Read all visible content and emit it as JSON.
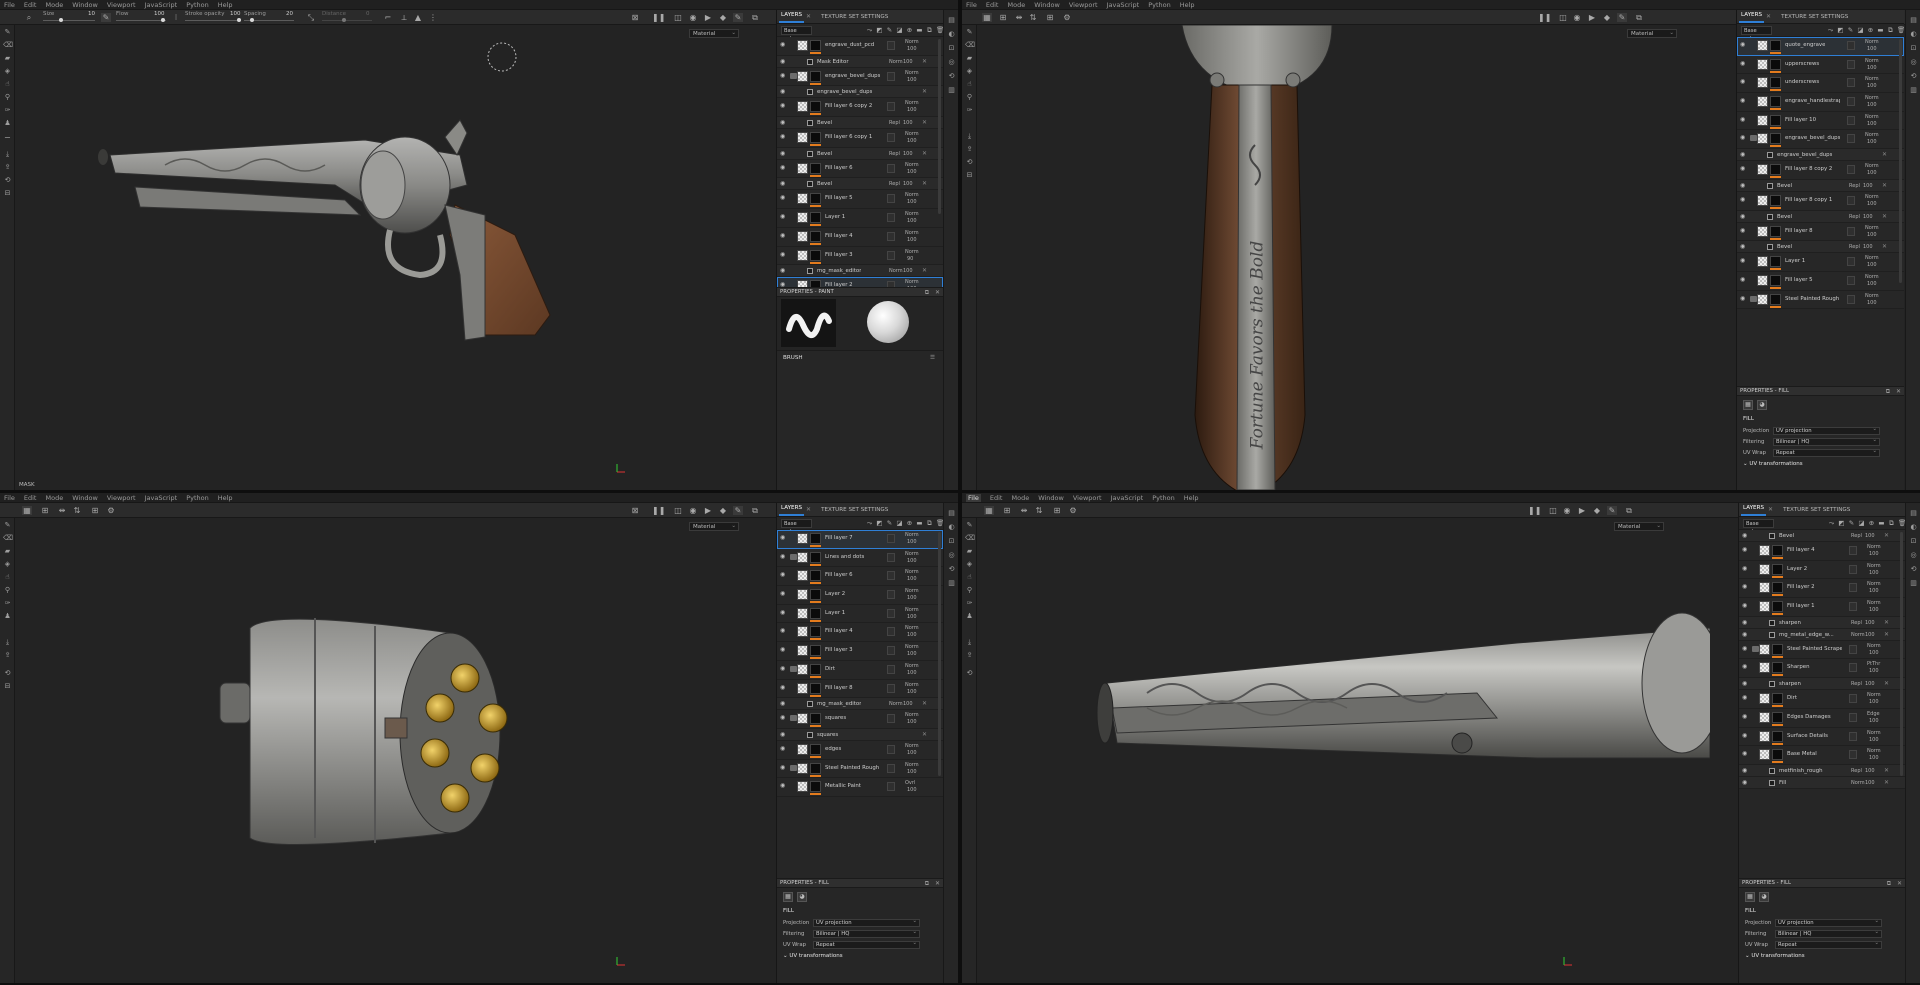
{
  "menu": [
    "File",
    "Edit",
    "Mode",
    "Window",
    "Viewport",
    "JavaScript",
    "Python",
    "Help"
  ],
  "toolbar": {
    "size_label": "Size",
    "size_value": "10",
    "flow_label": "Flow",
    "flow_value": "100",
    "stroke_label": "Stroke opacity",
    "stroke_value": "100",
    "spacing_label": "Spacing",
    "spacing_value": "20",
    "distance_label": "Distance",
    "distance_value": "0"
  },
  "tabs": {
    "layers": "LAYERS",
    "texture_set": "TEXTURE SET SETTINGS"
  },
  "channel": "Base color",
  "material_select": "Material",
  "mask_label": "MASK",
  "panel1": {
    "layers": [
      {
        "name": "engrave_dust_pcd",
        "blend": "Norm",
        "opacity": "100",
        "type": "fill",
        "kind": "paint"
      },
      {
        "name": "Mask Editor",
        "blend": "Norm",
        "opacity": "100",
        "sub": true
      },
      {
        "name": "engrave_bevel_dups",
        "blend": "Norm",
        "opacity": "100",
        "type": "folder"
      },
      {
        "name": "engrave_bevel_dups",
        "sub": true,
        "anchor": true
      },
      {
        "name": "Fill layer 6 copy 2",
        "blend": "Norm",
        "opacity": "100"
      },
      {
        "name": "Bevel",
        "blend": "Repl",
        "opacity": "100",
        "sub": true
      },
      {
        "name": "Fill layer 6 copy 1",
        "blend": "Norm",
        "opacity": "100"
      },
      {
        "name": "Bevel",
        "blend": "Repl",
        "opacity": "100",
        "sub": true
      },
      {
        "name": "Fill layer 6",
        "blend": "Norm",
        "opacity": "100"
      },
      {
        "name": "Bevel",
        "blend": "Repl",
        "opacity": "100",
        "sub": true
      },
      {
        "name": "Fill layer 5",
        "blend": "Norm",
        "opacity": "100"
      },
      {
        "name": "Layer 1",
        "blend": "Norm",
        "opacity": "100"
      },
      {
        "name": "Fill layer 4",
        "blend": "Norm",
        "opacity": "100"
      },
      {
        "name": "Fill layer 3",
        "blend": "Norm",
        "opacity": "90"
      },
      {
        "name": "mg_mask_editor",
        "blend": "Norm",
        "opacity": "100",
        "sub": true
      },
      {
        "name": "Fill layer 2",
        "blend": "Norm",
        "opacity": "100",
        "selected": true
      },
      {
        "name": "Curvature",
        "blend": "Norm",
        "opacity": "100",
        "sub": true
      }
    ],
    "props_title": "PROPERTIES - PAINT",
    "brush_label": "BRUSH"
  },
  "panel2": {
    "layers": [
      {
        "name": "quote_engrave",
        "blend": "Norm",
        "opacity": "100",
        "selected": true
      },
      {
        "name": "upperscrews",
        "blend": "Norm",
        "opacity": "100"
      },
      {
        "name": "underscrews",
        "blend": "Norm",
        "opacity": "100"
      },
      {
        "name": "engrave_handlestrap",
        "blend": "Norm",
        "opacity": "100"
      },
      {
        "name": "Fill layer 10",
        "blend": "Norm",
        "opacity": "100"
      },
      {
        "name": "engrave_bevel_dups",
        "blend": "Norm",
        "opacity": "100",
        "type": "folder"
      },
      {
        "name": "engrave_bevel_dups",
        "sub": true,
        "anchor": true
      },
      {
        "name": "Fill layer 8 copy 2",
        "blend": "Norm",
        "opacity": "100"
      },
      {
        "name": "Bevel",
        "blend": "Repl",
        "opacity": "100",
        "sub": true
      },
      {
        "name": "Fill layer 8 copy 1",
        "blend": "Norm",
        "opacity": "100"
      },
      {
        "name": "Bevel",
        "blend": "Repl",
        "opacity": "100",
        "sub": true
      },
      {
        "name": "Fill layer 8",
        "blend": "Norm",
        "opacity": "100"
      },
      {
        "name": "Bevel",
        "blend": "Repl",
        "opacity": "100",
        "sub": true
      },
      {
        "name": "Layer 1",
        "blend": "Norm",
        "opacity": "100"
      },
      {
        "name": "Fill layer 5",
        "blend": "Norm",
        "opacity": "100"
      },
      {
        "name": "Steel Painted Rough Da...",
        "blend": "Norm",
        "opacity": "100",
        "type": "folder"
      }
    ],
    "props_title": "PROPERTIES - FILL",
    "fill_title": "FILL",
    "projection_label": "Projection",
    "projection_value": "UV projection",
    "filtering_label": "Filtering",
    "filtering_value": "Bilinear | HQ",
    "uvwrap_label": "UV Wrap",
    "uvwrap_value": "Repeat",
    "uv_transform": "UV transformations"
  },
  "panel3": {
    "layers": [
      {
        "name": "Fill layer 7",
        "blend": "Norm",
        "opacity": "100",
        "selected": true
      },
      {
        "name": "Lines and dots",
        "blend": "Norm",
        "opacity": "100",
        "type": "folder"
      },
      {
        "name": "Fill layer 6",
        "blend": "Norm",
        "opacity": "100"
      },
      {
        "name": "Layer 2",
        "blend": "Norm",
        "opacity": "100"
      },
      {
        "name": "Layer 1",
        "blend": "Norm",
        "opacity": "100"
      },
      {
        "name": "Fill layer 4",
        "blend": "Norm",
        "opacity": "100"
      },
      {
        "name": "Fill layer 3",
        "blend": "Norm",
        "opacity": "100"
      },
      {
        "name": "Dirt",
        "blend": "Norm",
        "opacity": "100",
        "type": "folder"
      },
      {
        "name": "Fill layer 8",
        "blend": "Norm",
        "opacity": "100"
      },
      {
        "name": "mg_mask_editor",
        "blend": "Norm",
        "opacity": "100",
        "sub": true
      },
      {
        "name": "squares",
        "blend": "Norm",
        "opacity": "100",
        "type": "folder"
      },
      {
        "name": "squares",
        "sub": true,
        "anchor": true
      },
      {
        "name": "edges",
        "blend": "Norm",
        "opacity": "100"
      },
      {
        "name": "Steel Painted Rough Damaged",
        "blend": "Norm",
        "opacity": "100",
        "type": "folder"
      },
      {
        "name": "Metallic Paint",
        "blend": "Ovrl",
        "opacity": "100"
      }
    ],
    "props_title": "PROPERTIES - FILL",
    "fill_title": "FILL",
    "projection_label": "Projection",
    "projection_value": "UV projection",
    "filtering_label": "Filtering",
    "filtering_value": "Bilinear | HQ",
    "uvwrap_label": "UV Wrap",
    "uvwrap_value": "Repeat",
    "uv_transform": "UV transformations"
  },
  "panel4": {
    "layers": [
      {
        "name": "Bevel",
        "blend": "Repl",
        "opacity": "100",
        "sub": true
      },
      {
        "name": "Fill layer 4",
        "blend": "Norm",
        "opacity": "100"
      },
      {
        "name": "Layer 2",
        "blend": "Norm",
        "opacity": "100"
      },
      {
        "name": "Fill layer 2",
        "blend": "Norm",
        "opacity": "100"
      },
      {
        "name": "Fill layer 1",
        "blend": "Norm",
        "opacity": "100"
      },
      {
        "name": "sharpen",
        "blend": "Repl",
        "opacity": "100",
        "sub": true
      },
      {
        "name": "mg_metal_edge_w...",
        "blend": "Norm",
        "opacity": "100",
        "sub": true
      },
      {
        "name": "Steel Painted Scraped Green",
        "blend": "Norm",
        "opacity": "100",
        "type": "folder"
      },
      {
        "name": "Sharpen",
        "blend": "PtThr",
        "opacity": "100"
      },
      {
        "name": "sharpen",
        "blend": "Repl",
        "opacity": "100",
        "sub": true
      },
      {
        "name": "Dirt",
        "blend": "Norm",
        "opacity": "100"
      },
      {
        "name": "Edges Damages",
        "blend": "Edge",
        "opacity": "100"
      },
      {
        "name": "Surface Details",
        "blend": "Norm",
        "opacity": "100"
      },
      {
        "name": "Base Metal",
        "blend": "Norm",
        "opacity": "100"
      },
      {
        "name": "metfinish_rough",
        "blend": "Repl",
        "opacity": "100",
        "sub": true
      },
      {
        "name": "Fill",
        "blend": "Norm",
        "opacity": "100",
        "sub": true
      }
    ],
    "props_title": "PROPERTIES - FILL",
    "fill_title": "FILL",
    "projection_label": "Projection",
    "projection_value": "UV projection",
    "filtering_label": "Filtering",
    "filtering_value": "Bilinear | HQ",
    "uvwrap_label": "UV Wrap",
    "uvwrap_value": "Repeat",
    "uv_transform": "UV transformations"
  },
  "engraving_text": "Fortune Favors the Bold"
}
